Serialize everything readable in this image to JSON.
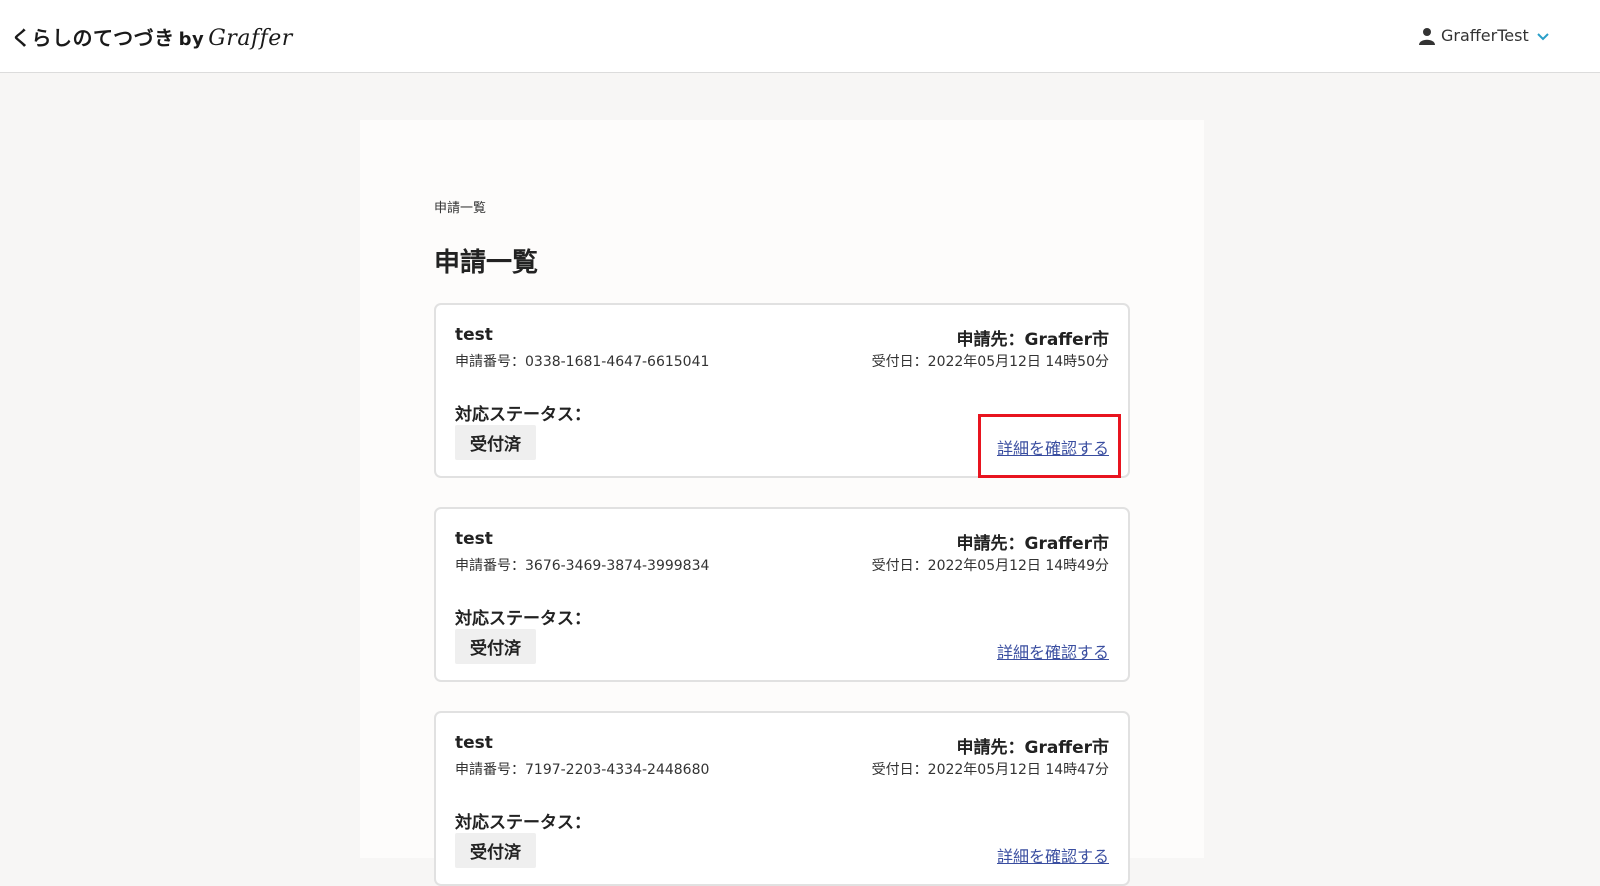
{
  "header": {
    "logo_text": "くらしのてつづき",
    "logo_by": "by",
    "logo_brand": "Graffer",
    "user_name": "GrafferTest"
  },
  "breadcrumb": "申請一覧",
  "page_title": "申請一覧",
  "labels": {
    "status": "対応ステータス：",
    "detail_link": "詳細を確認する"
  },
  "cards": [
    {
      "name": "test",
      "number": "申請番号：0338-1681-4647-6615041",
      "destination": "申請先：Graffer市",
      "date": "受付日：2022年05月12日 14時50分",
      "status": "受付済"
    },
    {
      "name": "test",
      "number": "申請番号：3676-3469-3874-3999834",
      "destination": "申請先：Graffer市",
      "date": "受付日：2022年05月12日 14時49分",
      "status": "受付済"
    },
    {
      "name": "test",
      "number": "申請番号：7197-2203-4334-2448680",
      "destination": "申請先：Graffer市",
      "date": "受付日：2022年05月12日 14時47分",
      "status": "受付済"
    }
  ],
  "colors": {
    "link": "#3a4ea0",
    "highlight": "#e8141f",
    "user_chevron": "#2a9fc9"
  }
}
